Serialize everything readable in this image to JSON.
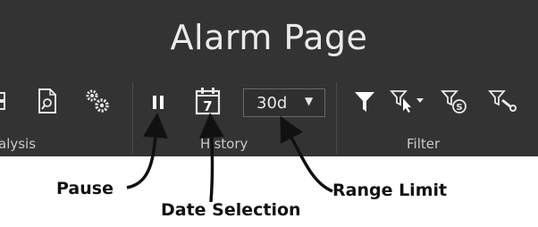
{
  "window": {
    "title": "Alarm Page"
  },
  "ribbon": {
    "groups": [
      {
        "label": "alysis"
      },
      {
        "label": "History"
      },
      {
        "label": "Filter"
      }
    ],
    "history": {
      "pause_icon": "pause-icon",
      "calendar_icon": "calendar-icon",
      "calendar_day": "7",
      "range_value": "30d"
    },
    "analysis": {
      "icons": [
        "search-document-icon",
        "gears-icon"
      ]
    },
    "filter": {
      "icons": [
        "filter-icon",
        "filter-select-dropdown-icon",
        "filter-s-icon",
        "filter-tool-icon"
      ]
    }
  },
  "annotations": {
    "pause": "Pause",
    "date_selection": "Date Selection",
    "range_limit": "Range Limit"
  },
  "colors": {
    "ribbon_bg": "#333333",
    "title_text": "#eaeaea",
    "icon": "#ffffff",
    "annotation_text": "#111111"
  }
}
